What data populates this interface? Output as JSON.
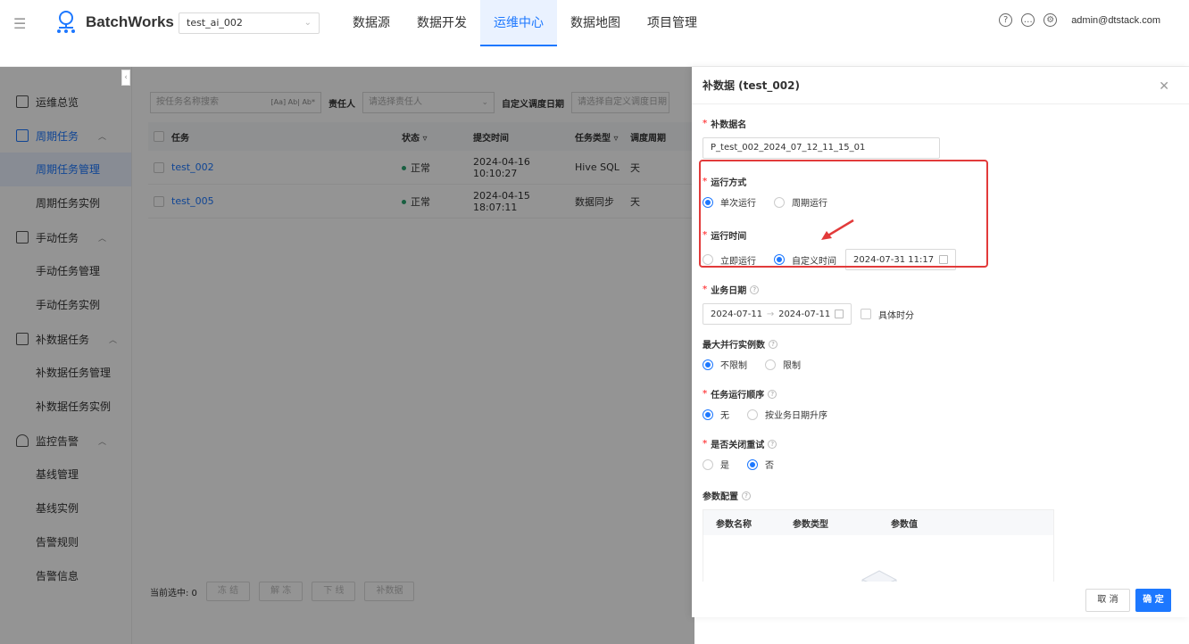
{
  "header": {
    "app_name": "BatchWorks",
    "project": "test_ai_002",
    "nav": [
      "数据源",
      "数据开发",
      "运维中心",
      "数据地图",
      "项目管理"
    ],
    "active_nav": "运维中心",
    "user": "admin@dtstack.com"
  },
  "sidebar": {
    "groups": [
      {
        "label": "运维总览",
        "items": []
      },
      {
        "label": "周期任务",
        "items": [
          "周期任务管理",
          "周期任务实例"
        ]
      },
      {
        "label": "手动任务",
        "items": [
          "手动任务管理",
          "手动任务实例"
        ]
      },
      {
        "label": "补数据任务",
        "items": [
          "补数据任务管理",
          "补数据任务实例"
        ]
      },
      {
        "label": "监控告警",
        "items": [
          "基线管理",
          "基线实例",
          "告警规则",
          "告警信息"
        ]
      }
    ],
    "active_item": "周期任务管理"
  },
  "filters": {
    "search_placeholder": "按任务名称搜索",
    "search_tags": "[Aa] Ab| Ab*",
    "owner_label": "责任人",
    "owner_placeholder": "请选择责任人",
    "date_label": "自定义调度日期",
    "date_placeholder": "请选择自定义调度日期"
  },
  "table": {
    "columns": [
      "任务",
      "状态",
      "提交时间",
      "任务类型",
      "调度周期"
    ],
    "rows": [
      {
        "name": "test_002",
        "status": "正常",
        "time": "2024-04-16 10:10:27",
        "type": "Hive SQL",
        "cycle": "天"
      },
      {
        "name": "test_005",
        "status": "正常",
        "time": "2024-04-15 18:07:11",
        "type": "数据同步",
        "cycle": "天"
      }
    ]
  },
  "footer": {
    "selected": "当前选中: 0",
    "buttons": [
      "冻 结",
      "解 冻",
      "下 线",
      "补数据"
    ]
  },
  "drawer": {
    "title": "补数据 (test_002)",
    "name_label": "补数据名",
    "name_value": "P_test_002_2024_07_12_11_15_01",
    "run_mode_label": "运行方式",
    "run_mode_options": [
      "单次运行",
      "周期运行"
    ],
    "run_time_label": "运行时间",
    "run_time_options": [
      "立即运行",
      "自定义时间"
    ],
    "run_time_value": "2024-07-31 11:17",
    "biz_date_label": "业务日期",
    "biz_date_start": "2024-07-11",
    "biz_date_end": "2024-07-11",
    "biz_date_arrow": "→",
    "specific_time": "具体时分",
    "max_parallel_label": "最大并行实例数",
    "max_parallel_options": [
      "不限制",
      "限制"
    ],
    "order_label": "任务运行顺序",
    "order_options": [
      "无",
      "按业务日期升序"
    ],
    "retry_label": "是否关闭重试",
    "retry_options": [
      "是",
      "否"
    ],
    "param_label": "参数配置",
    "param_columns": [
      "参数名称",
      "参数类型",
      "参数值"
    ],
    "cancel": "取 消",
    "ok": "确 定"
  },
  "colors": {
    "accent": "#1d78ff",
    "highlight": "#e23a3a"
  }
}
